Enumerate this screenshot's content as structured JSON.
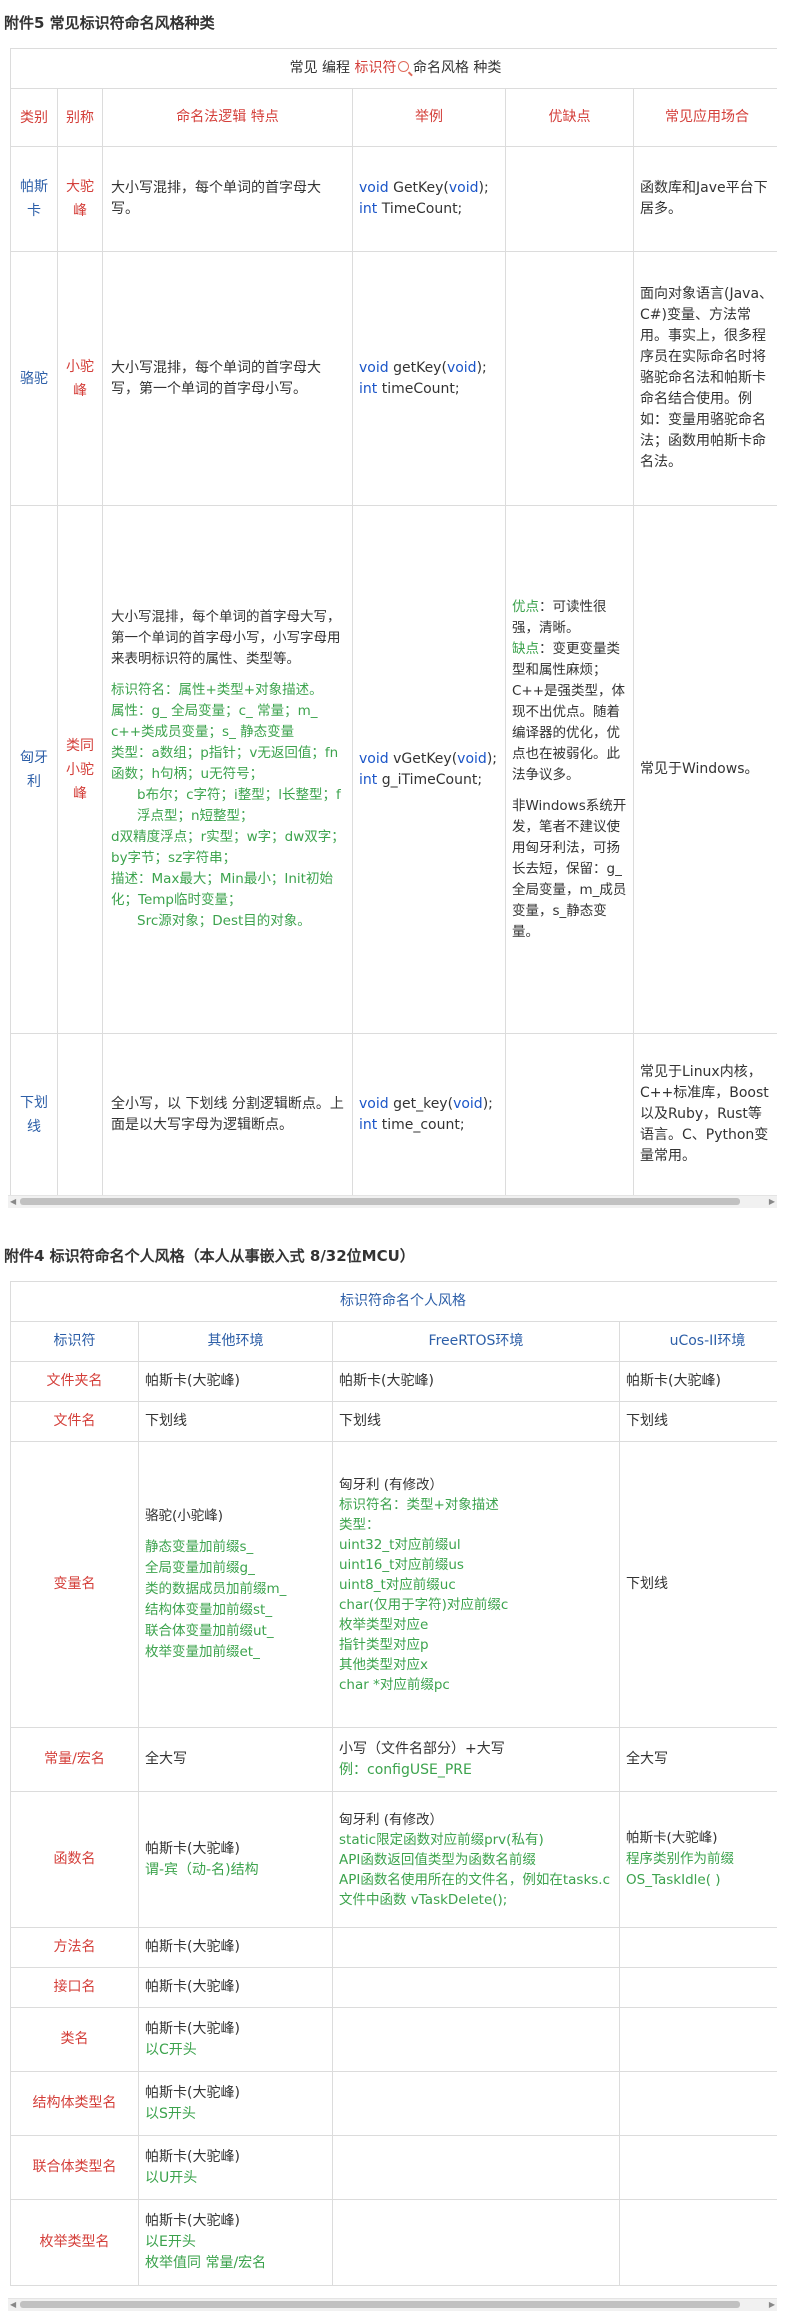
{
  "t1": {
    "caption": "附件5 常见标识符命名风格种类",
    "banner": [
      "常见 编程 ",
      "标识符",
      " 命名风格 种类"
    ],
    "headers": [
      "类别",
      "别称",
      "命名法逻辑 特点",
      "举例",
      "优缺点",
      "常见应用场合"
    ],
    "r1": {
      "cat": "帕斯卡",
      "alias": "大驼峰",
      "desc": "大小写混排，每个单词的首字母大写。",
      "ex1a": "void",
      "ex1b": " GetKey(",
      "ex1c": "void",
      "ex1d": ");",
      "ex2a": "int",
      "ex2b": " TimeCount;",
      "pros": "",
      "use": "函数库和Jave平台下居多。"
    },
    "r2": {
      "cat": "骆驼",
      "alias": "小驼峰",
      "desc": "大小写混排，每个单词的首字母大写，第一个单词的首字母小写。",
      "ex1a": "void",
      "ex1b": " getKey(",
      "ex1c": "void",
      "ex1d": ");",
      "ex2a": "int",
      "ex2b": " timeCount;",
      "pros": "",
      "use": "面向对象语言(Java、C#)变量、方法常用。事实上，很多程序员在实际命名时将骆驼命名法和帕斯卡命名结合使用。例如：变量用骆驼命名法；函数用帕斯卡命名法。"
    },
    "r3": {
      "cat": "匈牙利",
      "alias": "类同小驼峰",
      "desc": "大小写混排，每个单词的首字母大写，第一个单词的首字母小写，小写字母用来表明标识符的属性、类型等。",
      "g1": "标识符名：属性+类型+对象描述。",
      "g2": "属性：g_ 全局变量；c_ 常量；m_ c++类成员变量；s_ 静态变量",
      "g3": "类型：a数组；p指针；v无返回值；fn函数；h句柄；u无符号；",
      "g4": "b布尔；c字符；i整型；l长整型；f浮点型；n短整型；",
      "g5": "d双精度浮点；r实型；w字；dw双字；by字节；sz字符串；",
      "g6": "描述：Max最大；Min最小；Init初始化；Temp临时变量；",
      "g7": "Src源对象；Dest目的对象。",
      "ex1a": "void",
      "ex1b": " vGetKey(",
      "ex1c": "void",
      "ex1d": ");",
      "ex2a": "int",
      "ex2b": " g_iTimeCount;",
      "pros_a1": "优点",
      "pros_a2": "：可读性很强，清晰。",
      "pros_b1": "缺点",
      "pros_b2": "：变更变量类型和属性麻烦；C++是强类型，体现不出优点。随着编译器的优化，优点也在被弱化。此法争议多。",
      "pros_c": "非Windows系统开发，笔者不建议使用匈牙利法，可扬长去短，保留：g_全局变量，m_成员变量，s_静态变量。",
      "use": "常见于Windows。"
    },
    "r4": {
      "cat": "下划线",
      "alias": "",
      "desc": "全小写，以 下划线 分割逻辑断点。上面是以大写字母为逻辑断点。",
      "ex1a": "void",
      "ex1b": " get_key(",
      "ex1c": "void",
      "ex1d": ");",
      "ex2a": "int",
      "ex2b": " time_count;",
      "pros": "",
      "use": "常见于Linux内核，C++标准库，Boost以及Ruby，Rust等语言。C、Python变量常用。"
    }
  },
  "t2": {
    "caption": "附件4 标识符命名个人风格（本人从事嵌入式 8/32位MCU）",
    "banner": "标识符命名个人风格",
    "headers": [
      "标识符",
      "其他环境",
      "FreeRTOS环境",
      "uCos-II环境"
    ],
    "rows": {
      "folder": {
        "name": "文件夹名",
        "other": "帕斯卡(大驼峰)",
        "free": "帕斯卡(大驼峰)",
        "ucos": "帕斯卡(大驼峰)"
      },
      "file": {
        "name": "文件名",
        "other": "下划线",
        "free": "下划线",
        "ucos": "下划线"
      },
      "var": {
        "name": "变量名",
        "other0": "骆驼(小驼峰)",
        "other1": "静态变量加前缀s_",
        "other2": "全局变量加前缀g_",
        "other3": "类的数据成员加前缀m_",
        "other4": "结构体变量加前缀st_",
        "other5": "联合体变量加前缀ut_",
        "other6": "枚举变量加前缀et_",
        "free0": "匈牙利 (有修改）",
        "free1": "标识符名：类型+对象描述",
        "free2": "类型：",
        "free3": "uint32_t对应前缀ul",
        "free4": "uint16_t对应前缀us",
        "free5": "uint8_t对应前缀uc",
        "free6": "char(仅用于字符)对应前缀c",
        "free7": "枚举类型对应e",
        "free8": "指针类型对应p",
        "free9": "其他类型对应x",
        "free10": "char *对应前缀pc",
        "ucos": "下划线"
      },
      "const": {
        "name": "常量/宏名",
        "other": "全大写",
        "free1": "小写（文件名部分）+大写",
        "free2": "例：configUSE_PRE",
        "ucos": "全大写"
      },
      "func": {
        "name": "函数名",
        "other1": "帕斯卡(大驼峰)",
        "other2": "谓-宾（动-名)结构",
        "free0": "匈牙利 (有修改）",
        "free1": "static限定函数对应前缀prv(私有)",
        "free2": "API函数返回值类型为函数名前缀",
        "free3": "API函数名使用所在的文件名，例如在tasks.c文件中函数 vTaskDelete();",
        "ucos1": "帕斯卡(大驼峰)",
        "ucos2": "程序类别作为前缀",
        "ucos3": "OS_TaskIdle( )"
      },
      "method": {
        "name": "方法名",
        "other": "帕斯卡(大驼峰)"
      },
      "iface": {
        "name": "接口名",
        "other": "帕斯卡(大驼峰)"
      },
      "class": {
        "name": "类名",
        "other1": "帕斯卡(大驼峰)",
        "other2": "以C开头"
      },
      "struct": {
        "name": "结构体类型名",
        "other1": "帕斯卡(大驼峰)",
        "other2": "以S开头"
      },
      "union": {
        "name": "联合体类型名",
        "other1": "帕斯卡(大驼峰)",
        "other2": "以U开头"
      },
      "enum": {
        "name": "枚举类型名",
        "other1": "帕斯卡(大驼峰)",
        "other2": "以E开头",
        "other3": "枚举值同 常量/宏名"
      }
    }
  },
  "colors": {
    "header_red": "#d43f3a",
    "category_blue": "#2d5fa8",
    "green": "#3ca34d",
    "keyword_blue": "#1a55c8"
  }
}
